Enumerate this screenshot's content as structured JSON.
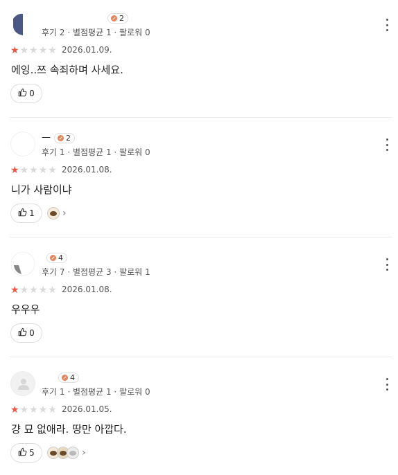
{
  "reviews": [
    {
      "nickname": "",
      "badge_count": "2",
      "stats": "후기 2 · 별점평균 1 · 팔로워 0",
      "rating": 1,
      "date": "2026.01.09.",
      "text": "에잉..쯔 속죄하며 사세요.",
      "likes": "0",
      "likers_count": 0,
      "avatar": "custom"
    },
    {
      "nickname": "—",
      "badge_count": "2",
      "stats": "후기 1 · 별점평균 1 · 팔로워 0",
      "rating": 1,
      "date": "2026.01.08.",
      "text": "니가 사람이냐",
      "likes": "1",
      "likers_count": 1,
      "avatar": "custom"
    },
    {
      "nickname": "",
      "badge_count": "4",
      "stats": "후기 7 · 별점평균 3 · 팔로워 1",
      "rating": 1,
      "date": "2026.01.08.",
      "text": "우우우",
      "likes": "0",
      "likers_count": 0,
      "avatar": "custom"
    },
    {
      "nickname": "",
      "badge_count": "4",
      "stats": "후기 1 · 별점평균 1 · 팔로워 0",
      "rating": 1,
      "date": "2026.01.05.",
      "text": "걍 묘 없애라. 땅만 아깝다.",
      "likes": "5",
      "likers_count": 3,
      "avatar": "default"
    }
  ],
  "icons": {
    "thumb": "thumbs-up-icon",
    "more": "more-vertical-icon",
    "badge": "badge-coin-icon",
    "chevron": "chevron-right-icon",
    "star": "star-icon"
  },
  "colors": {
    "star_active": "#f05444",
    "star_inactive": "#d9d9d9",
    "badge_coin": "#e4825a"
  }
}
